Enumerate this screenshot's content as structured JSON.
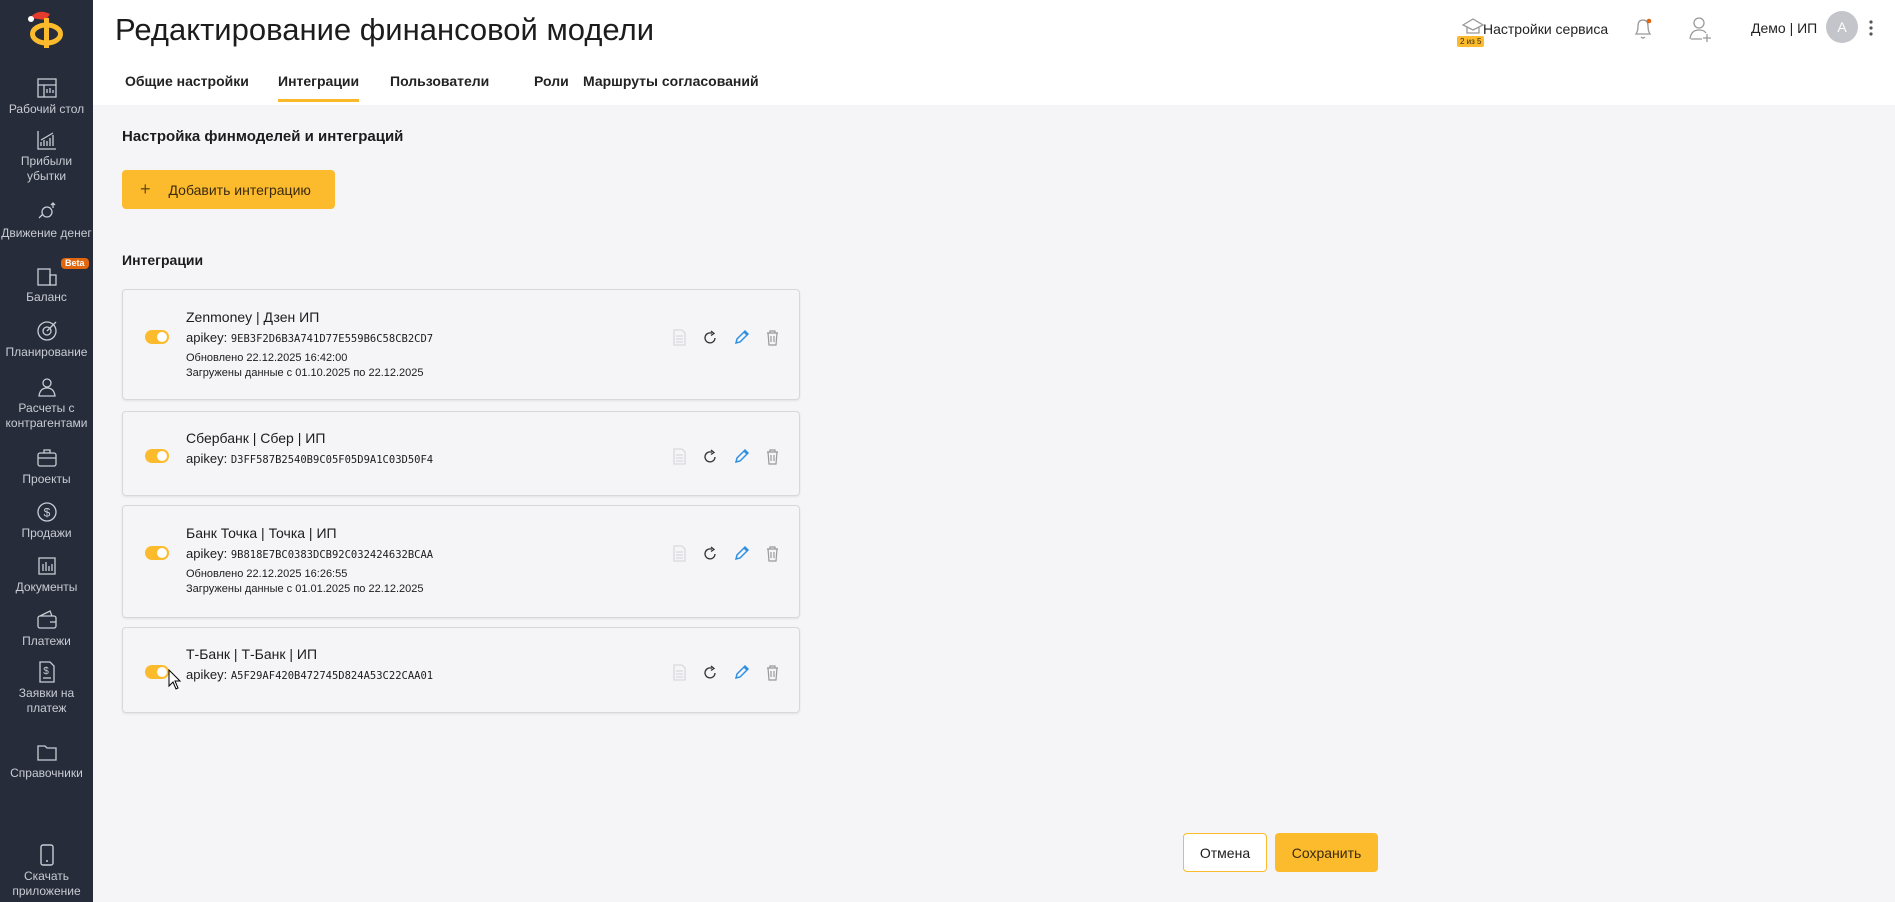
{
  "sidebar": {
    "logo_letter": "Ф",
    "beta": "Beta",
    "items": [
      {
        "label": "Рабочий стол",
        "icon": "dashboard-icon"
      },
      {
        "label": "Прибыли убытки",
        "icon": "chart-icon"
      },
      {
        "label": "Движение денег",
        "icon": "money-flow-icon"
      },
      {
        "label": "Баланс",
        "icon": "balance-icon"
      },
      {
        "label": "Планирование",
        "icon": "target-icon"
      },
      {
        "label": "Расчеты с контрагентами",
        "icon": "people-icon"
      },
      {
        "label": "Проекты",
        "icon": "briefcase-icon"
      },
      {
        "label": "Продажи",
        "icon": "dollar-icon"
      },
      {
        "label": "Документы",
        "icon": "documents-icon"
      },
      {
        "label": "Платежи",
        "icon": "wallet-icon"
      },
      {
        "label": "Заявки на платеж",
        "icon": "invoice-icon"
      },
      {
        "label": "Справочники",
        "icon": "folder-icon"
      }
    ],
    "download": "Скачать приложение"
  },
  "header": {
    "title": "Редактирование финансовой модели",
    "service_badge": "2 из 5",
    "service_settings": "Настройки сервиса",
    "user": "Демо | ИП",
    "avatar": "А"
  },
  "tabs": [
    "Общие настройки",
    "Интеграции",
    "Пользователи",
    "Роли",
    "Маршруты согласований"
  ],
  "main": {
    "section_title": "Настройка финмоделей и интеграций",
    "add_button": "Добавить интеграцию",
    "integrations_title": "Интеграции",
    "apikey_label": "apikey:",
    "integrations": [
      {
        "name": "Zenmoney | Дзен ИП",
        "apikey": "9EB3F2D6B3A741D77E559B6C58CB2CD7",
        "updated": "Обновлено 22.12.2025 16:42:00",
        "loaded": "Загружены данные с 01.10.2025 по 22.12.2025",
        "enabled": true
      },
      {
        "name": "Сбербанк | Сбер | ИП",
        "apikey": "D3FF587B2540B9C05F05D9A1C03D50F4",
        "enabled": true
      },
      {
        "name": "Банк Точка | Точка | ИП",
        "apikey": "9B818E7BC0383DCB92C032424632BCAA",
        "updated": "Обновлено 22.12.2025 16:26:55",
        "loaded": "Загружены данные с 01.01.2025 по 22.12.2025",
        "enabled": true
      },
      {
        "name": "Т-Банк | Т-Банк | ИП",
        "apikey": "A5F29AF420B472745D824A53C22CAA01",
        "enabled": true
      }
    ]
  },
  "footer": {
    "cancel": "Отмена",
    "save": "Сохранить"
  },
  "colors": {
    "accent": "#fbbb2c",
    "sidebar": "#272c3a",
    "edit": "#2f8fe0"
  }
}
